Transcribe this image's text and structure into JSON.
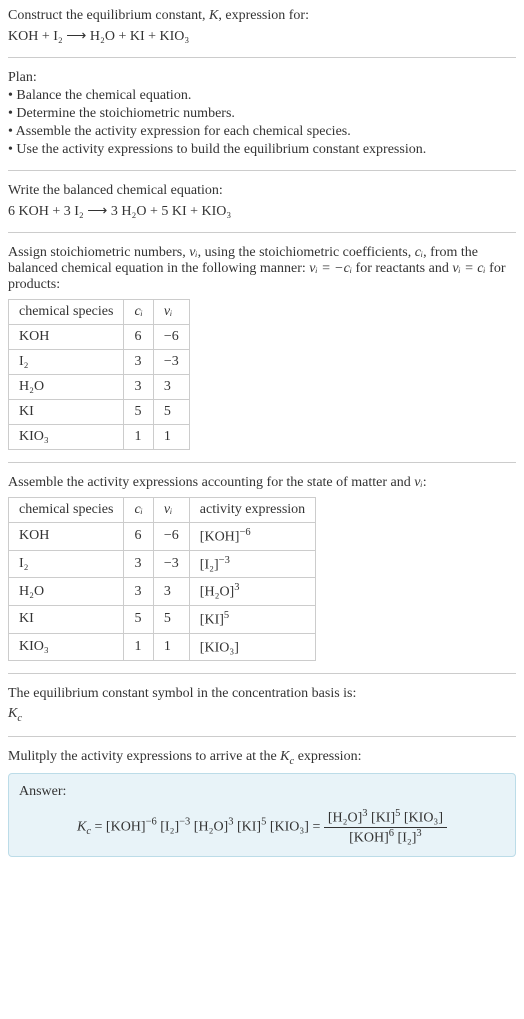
{
  "intro": {
    "line1": "Construct the equilibrium constant, ",
    "Kname": "K",
    "line1b": ", expression for:",
    "eq_unbalanced": "KOH + I₂ ⟶ H₂O + KI + KIO₃"
  },
  "plan": {
    "heading": "Plan:",
    "b1": "• Balance the chemical equation.",
    "b2": "• Determine the stoichiometric numbers.",
    "b3": "• Assemble the activity expression for each chemical species.",
    "b4": "• Use the activity expressions to build the equilibrium constant expression."
  },
  "balanced": {
    "heading": "Write the balanced chemical equation:",
    "eq": "6 KOH + 3 I₂ ⟶ 3 H₂O + 5 KI + KIO₃"
  },
  "stoich": {
    "text_a": "Assign stoichiometric numbers, ",
    "nu": "νᵢ",
    "text_b": ", using the stoichiometric coefficients, ",
    "ci": "cᵢ",
    "text_c": ", from the balanced chemical equation in the following manner: ",
    "rel1": "νᵢ = −cᵢ",
    "text_d": " for reactants and ",
    "rel2": "νᵢ = cᵢ",
    "text_e": " for products:",
    "table": {
      "h1": "chemical species",
      "h2": "cᵢ",
      "h3": "νᵢ",
      "rows": [
        {
          "sp": "KOH",
          "c": "6",
          "v": "−6"
        },
        {
          "sp": "I₂",
          "c": "3",
          "v": "−3"
        },
        {
          "sp": "H₂O",
          "c": "3",
          "v": "3"
        },
        {
          "sp": "KI",
          "c": "5",
          "v": "5"
        },
        {
          "sp": "KIO₃",
          "c": "1",
          "v": "1"
        }
      ]
    }
  },
  "activity": {
    "heading_a": "Assemble the activity expressions accounting for the state of matter and ",
    "nu": "νᵢ",
    "heading_b": ":",
    "table": {
      "h1": "chemical species",
      "h2": "cᵢ",
      "h3": "νᵢ",
      "h4": "activity expression",
      "rows": [
        {
          "sp": "KOH",
          "c": "6",
          "v": "−6",
          "a_base": "[KOH]",
          "a_exp": "−6"
        },
        {
          "sp": "I₂",
          "c": "3",
          "v": "−3",
          "a_base": "[I₂]",
          "a_exp": "−3"
        },
        {
          "sp": "H₂O",
          "c": "3",
          "v": "3",
          "a_base": "[H₂O]",
          "a_exp": "3"
        },
        {
          "sp": "KI",
          "c": "5",
          "v": "5",
          "a_base": "[KI]",
          "a_exp": "5"
        },
        {
          "sp": "KIO₃",
          "c": "1",
          "v": "1",
          "a_base": "[KIO₃]",
          "a_exp": ""
        }
      ]
    }
  },
  "symbol": {
    "line": "The equilibrium constant symbol in the concentration basis is:",
    "K": "K",
    "sub": "c"
  },
  "multiply": {
    "line_a": "Mulitply the activity expressions to arrive at the ",
    "K": "K",
    "sub": "c",
    "line_b": " expression:"
  },
  "answer": {
    "label": "Answer:",
    "Kc_K": "K",
    "Kc_sub": "c",
    "eq": " = ",
    "t1": "[KOH]",
    "e1": "−6",
    "t2": "[I₂]",
    "e2": "−3",
    "t3": "[H₂O]",
    "e3": "3",
    "t4": "[KI]",
    "e4": "5",
    "t5": "[KIO₃]",
    "eq2": " = ",
    "num_a": "[H₂O]",
    "num_ae": "3",
    "num_b": "[KI]",
    "num_be": "5",
    "num_c": "[KIO₃]",
    "den_a": "[KOH]",
    "den_ae": "6",
    "den_b": "[I₂]",
    "den_be": "3"
  },
  "chart_data": {
    "type": "table",
    "tables": [
      {
        "title": "Stoichiometric numbers",
        "columns": [
          "chemical species",
          "c_i",
          "v_i"
        ],
        "rows": [
          [
            "KOH",
            6,
            -6
          ],
          [
            "I2",
            3,
            -3
          ],
          [
            "H2O",
            3,
            3
          ],
          [
            "KI",
            5,
            5
          ],
          [
            "KIO3",
            1,
            1
          ]
        ]
      },
      {
        "title": "Activity expressions",
        "columns": [
          "chemical species",
          "c_i",
          "v_i",
          "activity expression"
        ],
        "rows": [
          [
            "KOH",
            6,
            -6,
            "[KOH]^-6"
          ],
          [
            "I2",
            3,
            -3,
            "[I2]^-3"
          ],
          [
            "H2O",
            3,
            3,
            "[H2O]^3"
          ],
          [
            "KI",
            5,
            5,
            "[KI]^5"
          ],
          [
            "KIO3",
            1,
            1,
            "[KIO3]"
          ]
        ]
      }
    ]
  }
}
